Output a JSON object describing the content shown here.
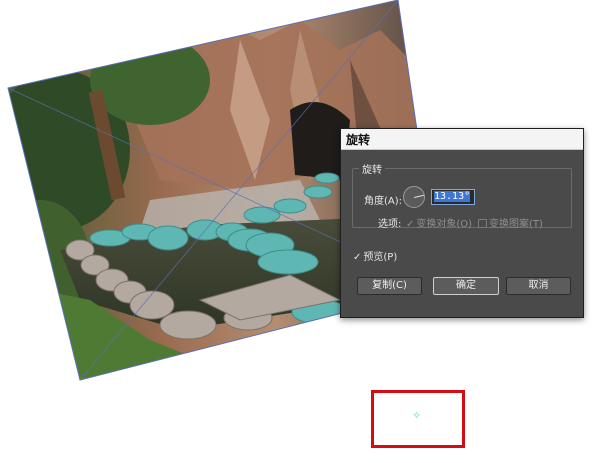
{
  "dialog": {
    "title": "旋转",
    "group_label": "旋转",
    "angle_label": "角度(A):",
    "angle_value": "13.13°",
    "options_label": "选项:",
    "transform_objects": {
      "label": "变换对象(O)",
      "checked": true
    },
    "transform_patterns": {
      "label": "变换图案(T)",
      "checked": false
    },
    "preview": {
      "label": "预览(P)",
      "checked": true
    },
    "buttons": {
      "copy": "复制(C)",
      "ok": "确定",
      "cancel": "取消"
    }
  },
  "canvas": {
    "center_point_icon": "crosshair-icon",
    "highlight_color": "#d40d12"
  }
}
